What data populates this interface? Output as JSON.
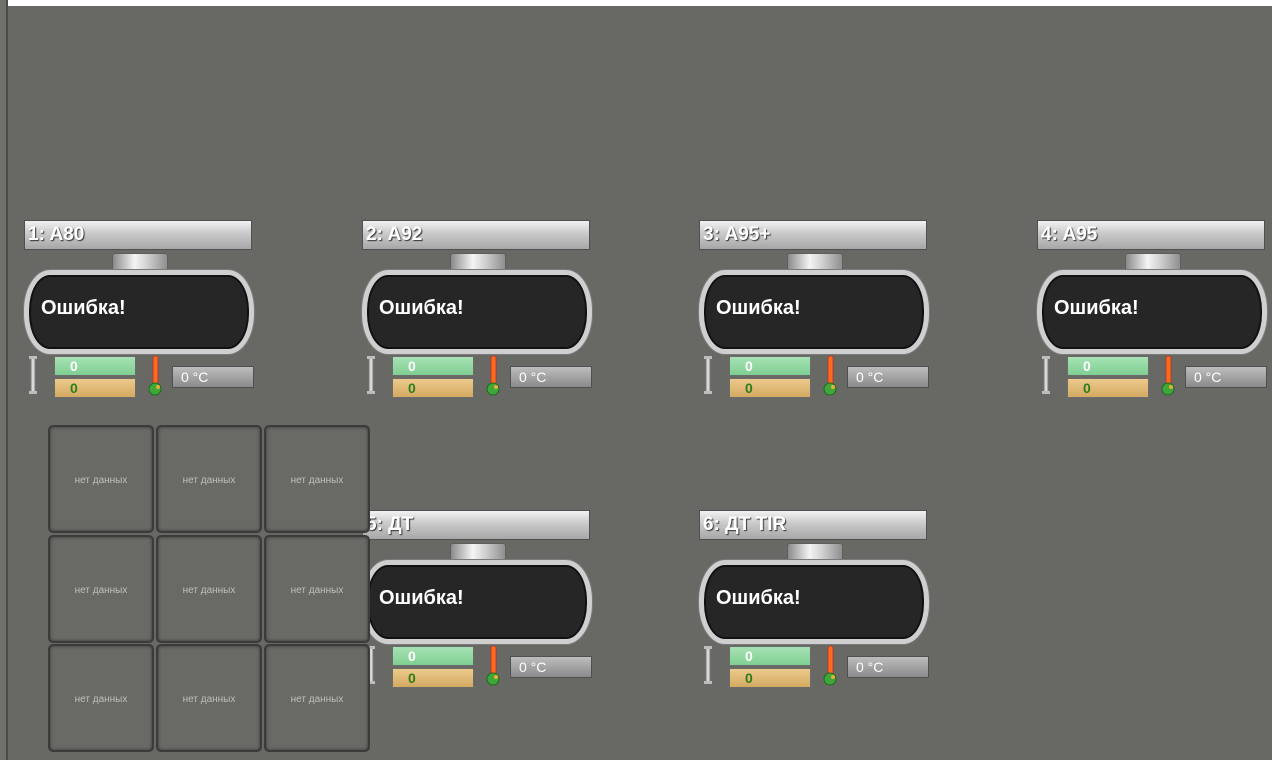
{
  "tanks": [
    {
      "title": "1: A80",
      "status": "Ошибка!",
      "level_top": "0",
      "level_bottom": "0",
      "temperature": "0 °C"
    },
    {
      "title": "2: A92",
      "status": "Ошибка!",
      "level_top": "0",
      "level_bottom": "0",
      "temperature": "0 °C"
    },
    {
      "title": "3: A95+",
      "status": "Ошибка!",
      "level_top": "0",
      "level_bottom": "0",
      "temperature": "0 °C"
    },
    {
      "title": "4: A95",
      "status": "Ошибка!",
      "level_top": "0",
      "level_bottom": "0",
      "temperature": "0 °C"
    },
    {
      "title": "5: ДТ",
      "status": "Ошибка!",
      "level_top": "0",
      "level_bottom": "0",
      "temperature": "0 °C"
    },
    {
      "title": "6: ДТ TIR",
      "status": "Ошибка!",
      "level_top": "0",
      "level_bottom": "0",
      "temperature": "0 °C"
    }
  ],
  "grid": {
    "cells": [
      "нет данных",
      "нет данных",
      "нет данных",
      "нет данных",
      "нет данных",
      "нет данных",
      "нет данных",
      "нет данных",
      "нет данных"
    ]
  },
  "colors": {
    "background": "#686964",
    "level_top": "#7fcf93",
    "level_bottom": "#d4aa62",
    "tank_body": "#262626"
  },
  "icons": {
    "gauge": "dipstick-icon",
    "thermometer": "thermometer-icon"
  }
}
